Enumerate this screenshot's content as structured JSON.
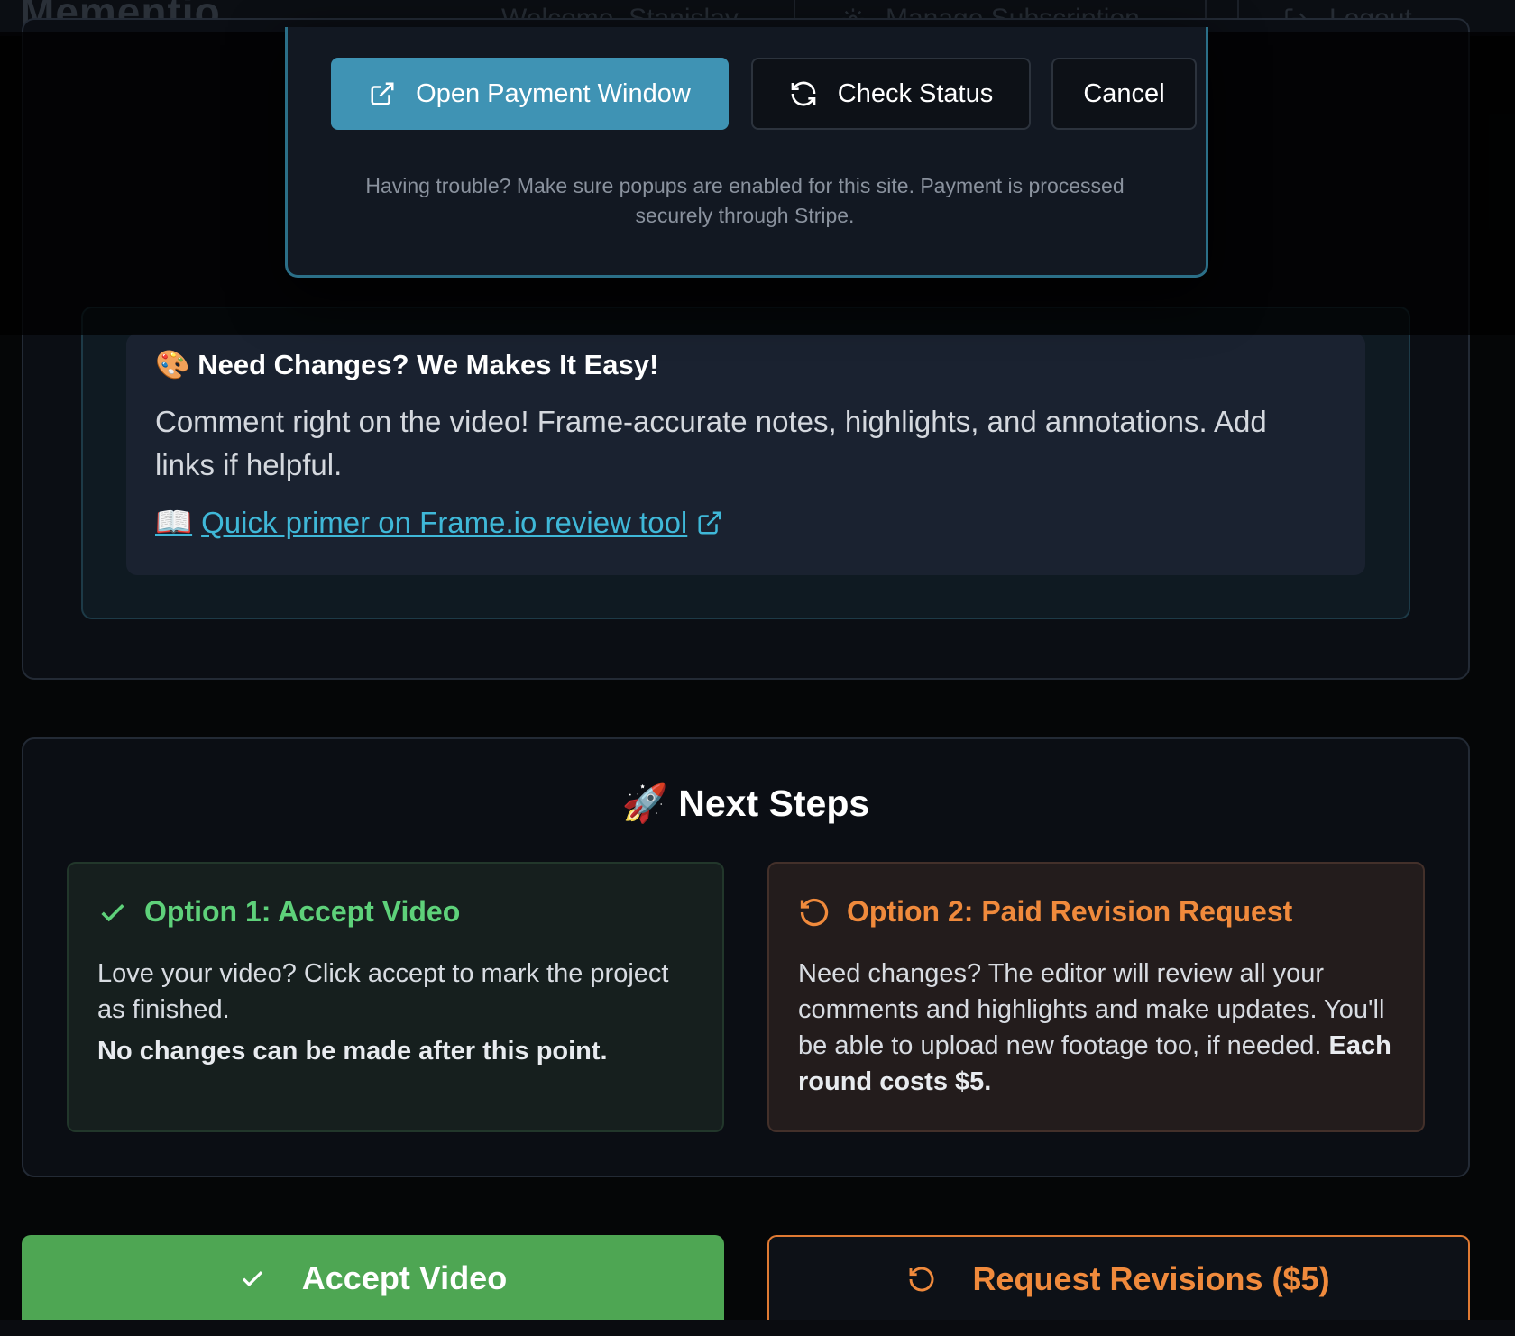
{
  "header": {
    "brand": "Mementio",
    "welcome": "Welcome, Stanislav",
    "manage_subscription": "Manage Subscription",
    "logout": "Logout"
  },
  "modal": {
    "open_payment_label": "Open Payment Window",
    "check_status_label": "Check Status",
    "cancel_label": "Cancel",
    "note": "Having trouble? Make sure popups are enabled for this site. Payment is processed securely through Stripe."
  },
  "changes": {
    "emoji": "🎨",
    "title": "Need Changes? We Makes It Easy!",
    "body": "Comment right on the video! Frame-accurate notes, highlights, and annotations. Add links if helpful.",
    "link_emoji": "📖",
    "link_text": "Quick primer on Frame.io review tool"
  },
  "next_steps": {
    "emoji": "🚀",
    "title": "Next Steps",
    "option1": {
      "title": "Option 1: Accept Video",
      "body": "Love your video? Click accept to mark the project as finished.",
      "strong": "No changes can be made after this point."
    },
    "option2": {
      "title": "Option 2: Paid Revision Request",
      "body": "Need changes? The editor will review all your comments and highlights and make updates. You'll be able to upload new footage too, if needed.",
      "strong": "Each round costs $5."
    }
  },
  "actions": {
    "accept_label": "Accept Video",
    "revise_label": "Request Revisions ($5)"
  },
  "colors": {
    "accent_teal": "#3f93b4",
    "accept_green": "#4ea653",
    "revision_orange": "#f08a3c"
  },
  "icons": [
    "external-link-icon",
    "refresh-icon",
    "gear-icon",
    "logout-icon",
    "check-icon",
    "undo-icon"
  ]
}
